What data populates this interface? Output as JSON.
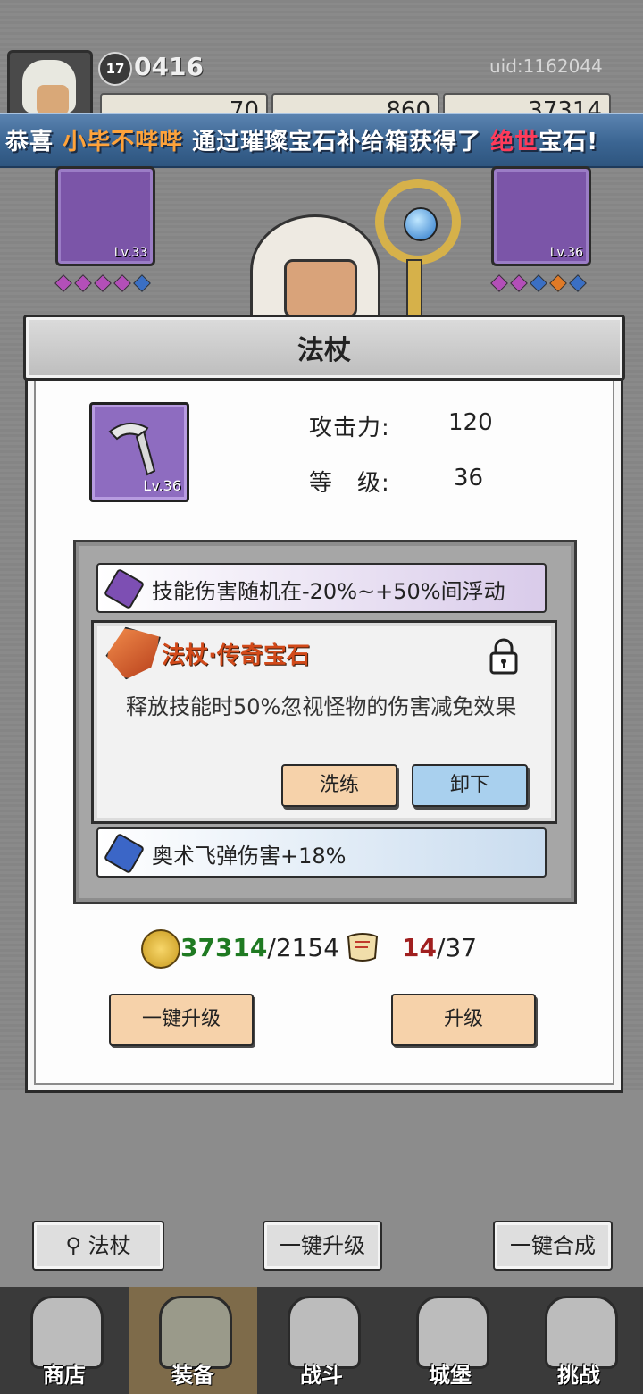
{
  "profile": {
    "level": "17",
    "power": "0416",
    "uid": "uid:1162044",
    "resources": [
      "70",
      "860",
      "37314"
    ]
  },
  "ticker": {
    "prefix": "恭喜",
    "player": "小毕不哔哔",
    "middle": "通过璀璨宝石补给箱获得了",
    "rarity": "绝世",
    "suffix": "宝石!"
  },
  "equip_slots": {
    "left_level": "Lv.33",
    "right_level": "Lv.36"
  },
  "modal": {
    "title": "法杖",
    "item_level": "Lv.36",
    "stats": [
      {
        "label": "攻击力:",
        "value": "120"
      },
      {
        "label": "等　级:",
        "value": "36"
      }
    ],
    "effects": {
      "top": "技能伤害随机在-20%~+50%间浮动",
      "legend_title": "法杖·传奇宝石",
      "legend_desc": "释放技能时50%忽视怪物的伤害减免效果",
      "refine_button": "洗练",
      "unequip_button": "卸下",
      "bottom": "奥术飞弹伤害+18%"
    },
    "cost": {
      "gold_have": "37314",
      "gold_need": "/2154",
      "scroll_have": "14",
      "scroll_need": "/37"
    },
    "upgrade_all_button": "一键升级",
    "upgrade_button": "升级"
  },
  "bottom_bar": {
    "filter_label": "法杖",
    "upgrade_all": "一键升级",
    "synthesize_all": "一键合成"
  },
  "nav": [
    {
      "label": "商店",
      "icon": "shop-icon"
    },
    {
      "label": "装备",
      "icon": "bag-icon",
      "active": true
    },
    {
      "label": "战斗",
      "icon": "swords-icon"
    },
    {
      "label": "城堡",
      "icon": "castle-icon"
    },
    {
      "label": "挑战",
      "icon": "shield-icon"
    }
  ],
  "colors": {
    "legend_title": "#d24a1a",
    "gold_have": "#1f7a22",
    "scroll_have": "#a01f1f",
    "ticker_player": "#ffa33a",
    "ticker_rarity": "#ff3b5a"
  }
}
